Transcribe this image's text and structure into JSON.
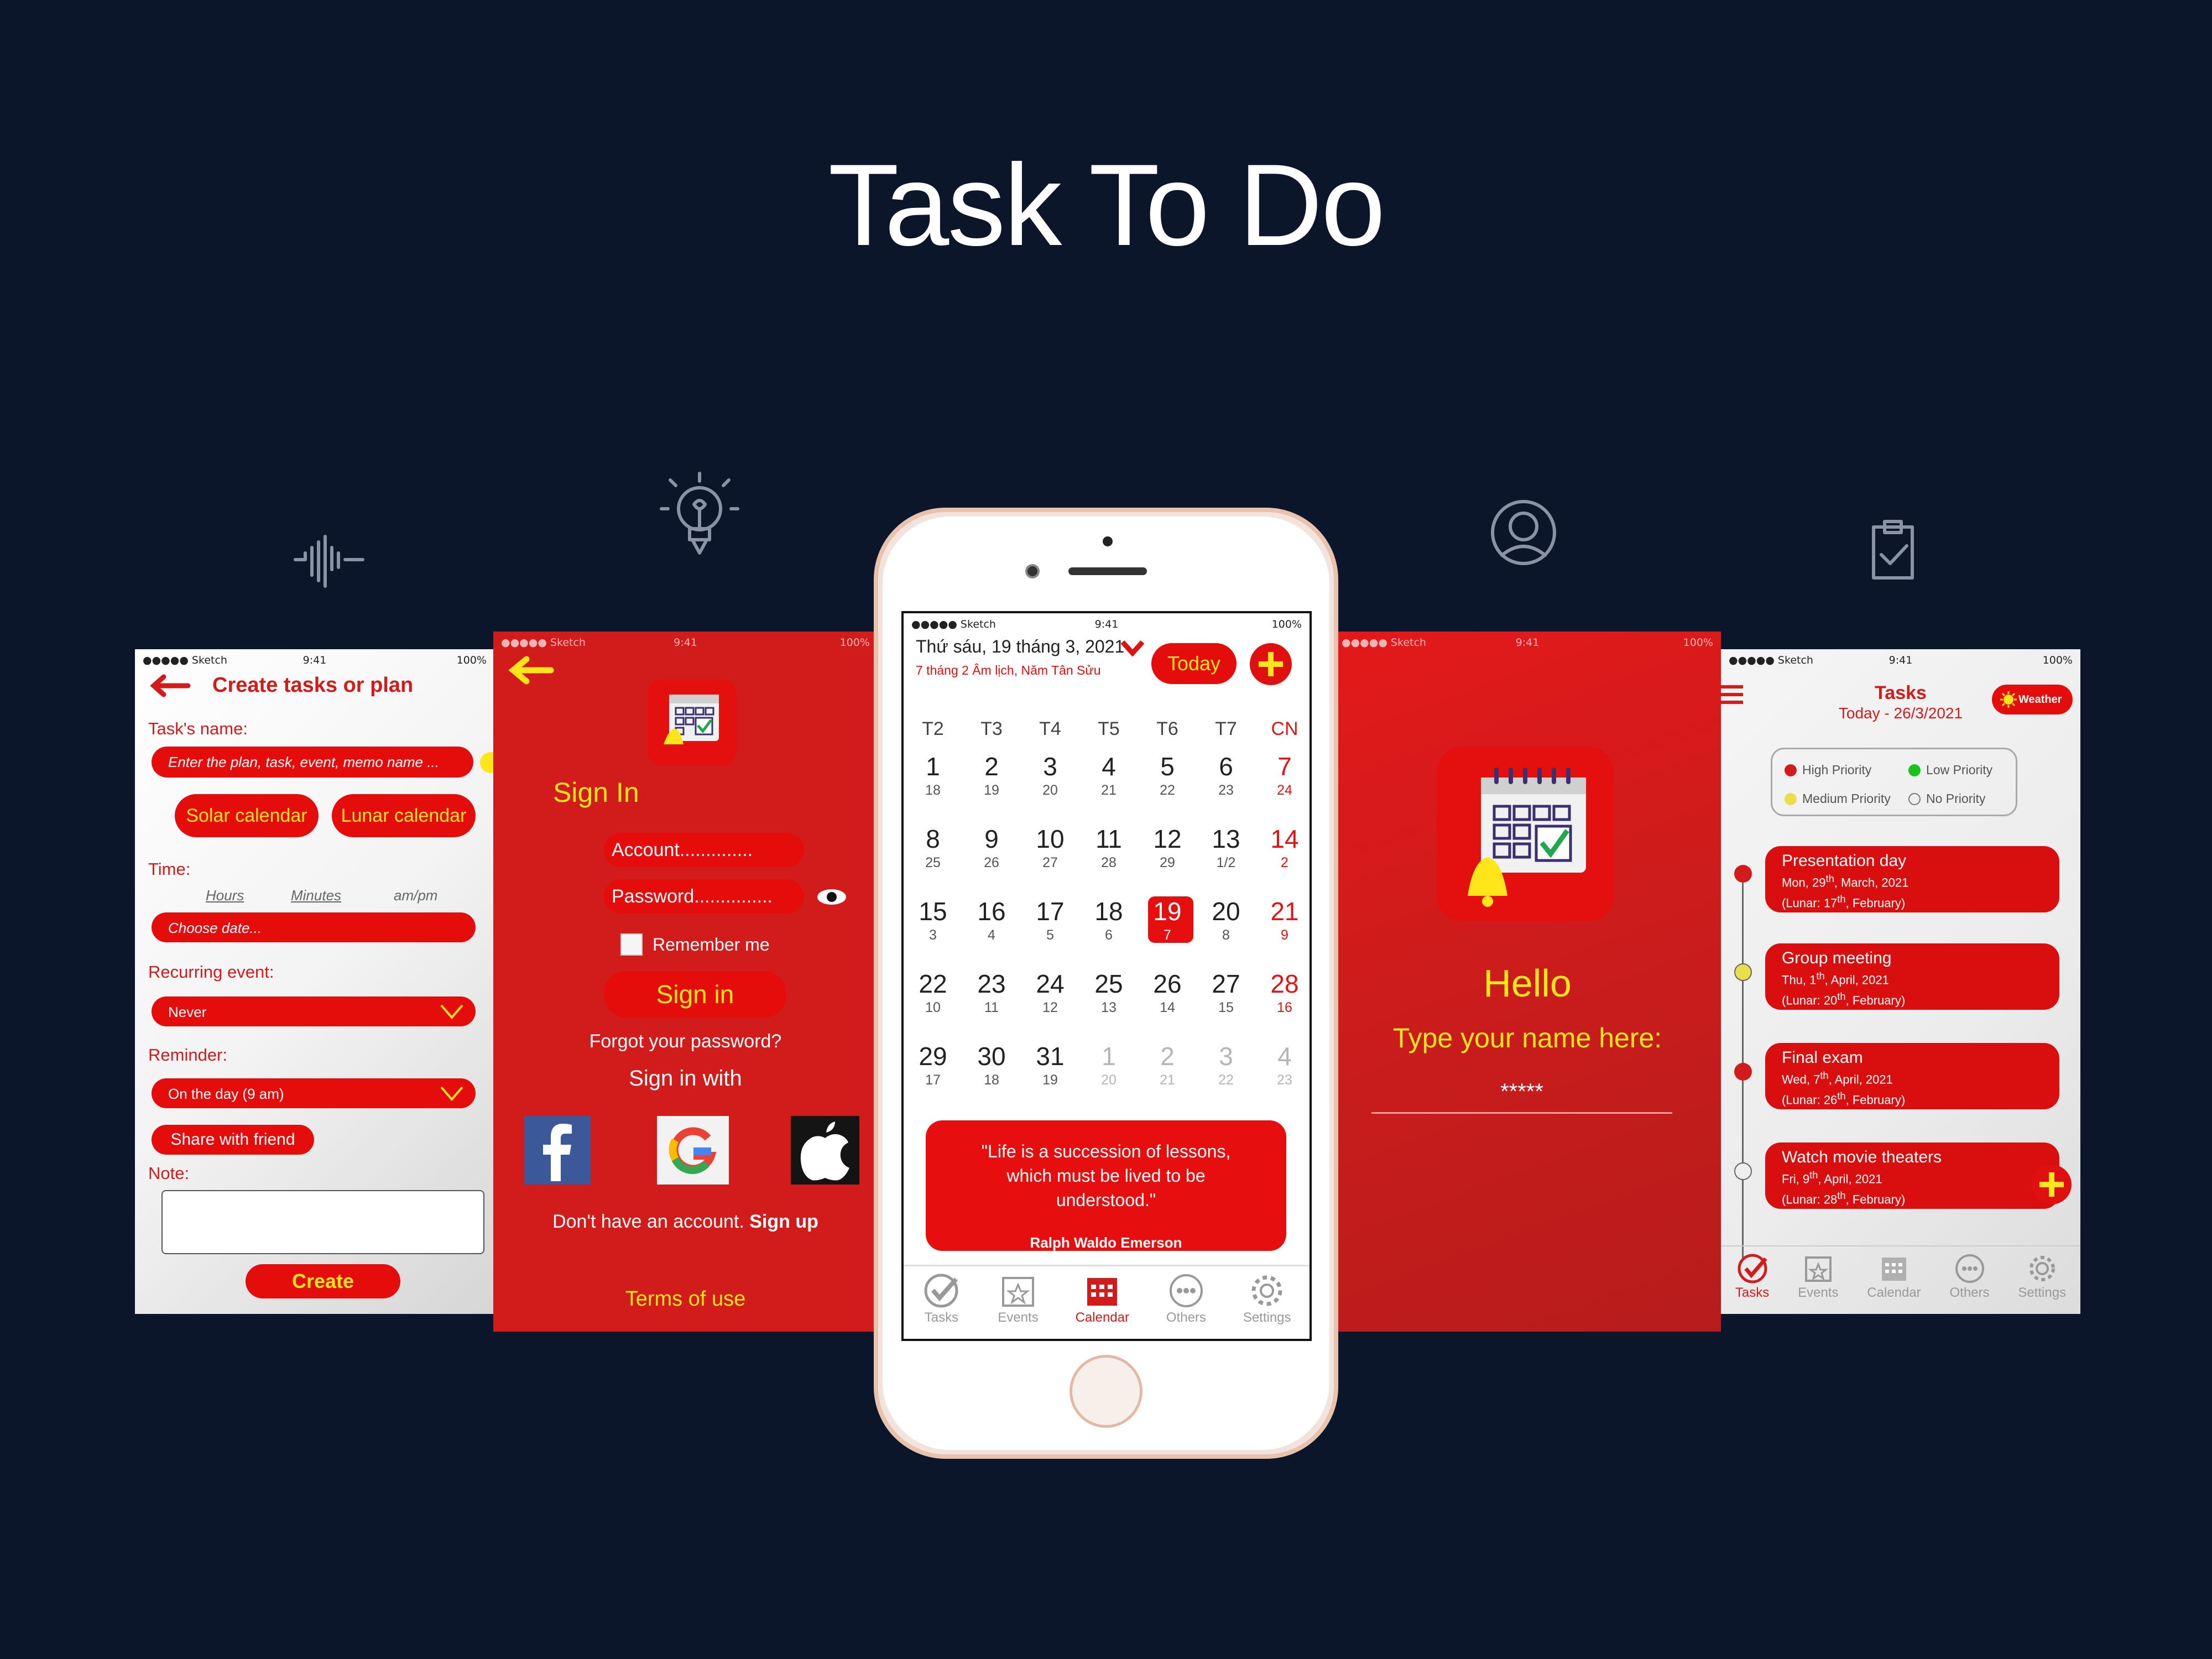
{
  "title": "Task To Do",
  "status_bar": {
    "carrier": "●●●●● Sketch",
    "time": "9:41",
    "battery": "100%"
  },
  "screen_create": {
    "header": "Create tasks or plan",
    "task_name_label": "Task's name:",
    "task_name_placeholder": "Enter the plan, task, event, memo name ...",
    "solar_button": "Solar calendar",
    "lunar_button": "Lunar calendar",
    "time_label": "Time:",
    "hours": "Hours",
    "minutes": "Minutes",
    "ampm": "am/pm",
    "date_placeholder": "Choose date...",
    "recurring_label": "Recurring event:",
    "recurring_value": "Never",
    "reminder_label": "Reminder:",
    "reminder_value": "On the day (9 am)",
    "share_button": "Share with friend",
    "note_label": "Note:",
    "create_button": "Create"
  },
  "screen_signin": {
    "title": "Sign In",
    "account_placeholder": "Account..............",
    "password_placeholder": "Password...............",
    "remember": "Remember me",
    "signin_button": "Sign in",
    "forgot": "Forgot your password?",
    "signin_with": "Sign in with",
    "no_account": "Don't have an account.",
    "signup": "Sign up",
    "terms": "Terms of use"
  },
  "screen_calendar": {
    "date_line": "Thứ sáu, 19 tháng 3, 2021",
    "lunar_line": "7 tháng 2 Âm lịch, Năm Tân Sửu",
    "today_button": "Today",
    "weekdays": [
      "T2",
      "T3",
      "T4",
      "T5",
      "T6",
      "T7",
      "CN"
    ],
    "days": [
      {
        "d": "1",
        "l": "18"
      },
      {
        "d": "2",
        "l": "19"
      },
      {
        "d": "3",
        "l": "20"
      },
      {
        "d": "4",
        "l": "21"
      },
      {
        "d": "5",
        "l": "22"
      },
      {
        "d": "6",
        "l": "23"
      },
      {
        "d": "7",
        "l": "24"
      },
      {
        "d": "8",
        "l": "25"
      },
      {
        "d": "9",
        "l": "26"
      },
      {
        "d": "10",
        "l": "27"
      },
      {
        "d": "11",
        "l": "28"
      },
      {
        "d": "12",
        "l": "29"
      },
      {
        "d": "13",
        "l": "1/2"
      },
      {
        "d": "14",
        "l": "2"
      },
      {
        "d": "15",
        "l": "3"
      },
      {
        "d": "16",
        "l": "4"
      },
      {
        "d": "17",
        "l": "5"
      },
      {
        "d": "18",
        "l": "6"
      },
      {
        "d": "19",
        "l": "7"
      },
      {
        "d": "20",
        "l": "8"
      },
      {
        "d": "21",
        "l": "9"
      },
      {
        "d": "22",
        "l": "10"
      },
      {
        "d": "23",
        "l": "11"
      },
      {
        "d": "24",
        "l": "12"
      },
      {
        "d": "25",
        "l": "13"
      },
      {
        "d": "26",
        "l": "14"
      },
      {
        "d": "27",
        "l": "15"
      },
      {
        "d": "28",
        "l": "16"
      },
      {
        "d": "29",
        "l": "17"
      },
      {
        "d": "30",
        "l": "18"
      },
      {
        "d": "31",
        "l": "19"
      },
      {
        "d": "1",
        "l": "20"
      },
      {
        "d": "2",
        "l": "21"
      },
      {
        "d": "3",
        "l": "22"
      },
      {
        "d": "4",
        "l": "23"
      }
    ],
    "today_index": 18,
    "quote": "\"Life is a succession of lessons, which must be lived to be understood.\"",
    "quote_author": "Ralph Waldo Emerson",
    "tabs": [
      "Tasks",
      "Events",
      "Calendar",
      "Others",
      "Settings"
    ],
    "active_tab": "Calendar"
  },
  "screen_hello": {
    "greeting": "Hello",
    "prompt": "Type your name here:",
    "name_value": "*****"
  },
  "screen_tasks": {
    "title": "Tasks",
    "subtitle": "Today - 26/3/2021",
    "weather_button": "Weather",
    "legend": [
      "High Priority",
      "Low Priority",
      "Medium Priority",
      "No Priority"
    ],
    "tasks": [
      {
        "name": "Presentation day",
        "date": "Mon, 29",
        "sup": "th",
        "date_rest": ", March, 2021",
        "lunar": "(Lunar: 17",
        "lunar_sup": "th",
        "lunar_rest": ", February)",
        "priority": "high"
      },
      {
        "name": "Group meeting",
        "date": "Thu, 1",
        "sup": "th",
        "date_rest": ", April, 2021",
        "lunar": "(Lunar: 20",
        "lunar_sup": "th",
        "lunar_rest": ", February)",
        "priority": "medium"
      },
      {
        "name": "Final exam",
        "date": "Wed, 7",
        "sup": "th",
        "date_rest": ", April, 2021",
        "lunar": "(Lunar: 26",
        "lunar_sup": "th",
        "lunar_rest": ", February)",
        "priority": "high"
      },
      {
        "name": "Watch movie theaters",
        "date": "Fri, 9",
        "sup": "th",
        "date_rest": ", April, 2021",
        "lunar": "(Lunar: 28",
        "lunar_sup": "th",
        "lunar_rest": ", February)",
        "priority": "none"
      }
    ],
    "tabs": [
      "Tasks",
      "Events",
      "Calendar",
      "Others",
      "Settings"
    ],
    "active_tab": "Tasks"
  },
  "colors": {
    "background": "#0c162a",
    "accent": "#d21b1b",
    "yellow": "#ffe51a",
    "high": "#d21b1b",
    "medium": "#e8e04a",
    "low": "#1cc21c"
  }
}
